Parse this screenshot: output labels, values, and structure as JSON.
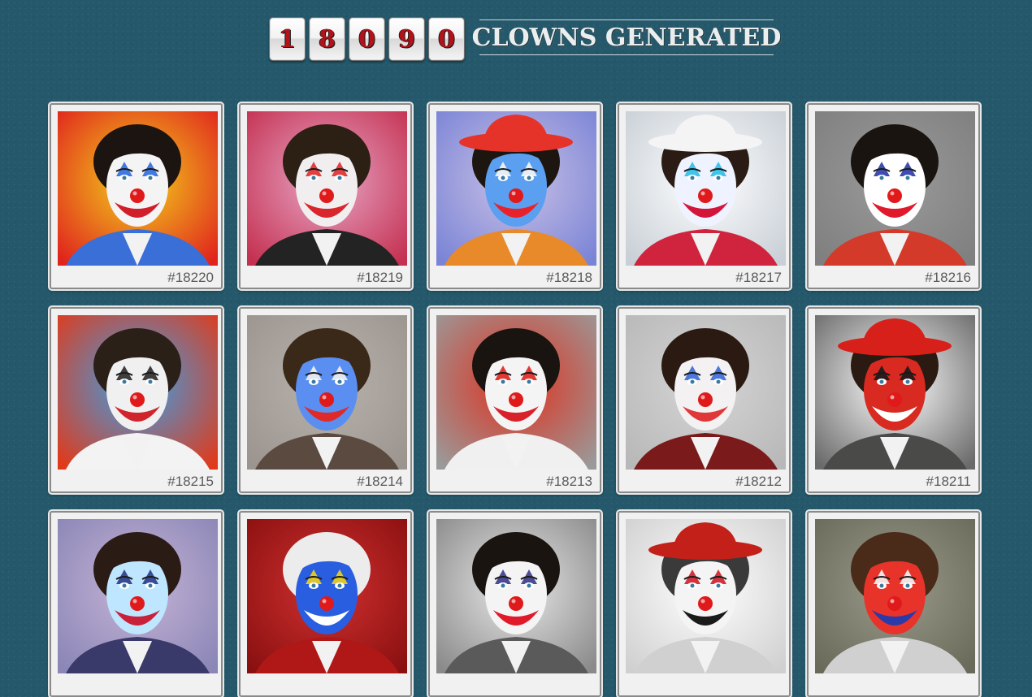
{
  "counter": {
    "digits": [
      "1",
      "8",
      "0",
      "9",
      "0"
    ],
    "label": "CLOWNS GENERATED"
  },
  "cards": [
    {
      "id": "#18220",
      "bg1": "#f3d21c",
      "bg2": "#e0231d",
      "face": "#f4f4f4",
      "paint": "#2f6be0",
      "mouth": "#d01e2a",
      "hair": "#1b1410",
      "suit": "#3b6fd8"
    },
    {
      "id": "#18219",
      "bg1": "#e8a7c8",
      "bg2": "#c43050",
      "face": "#f1eef0",
      "paint": "#e02c2c",
      "mouth": "#d8262c",
      "hair": "#2c1f14",
      "suit": "#232323"
    },
    {
      "id": "#18218",
      "bg1": "#c9c0e5",
      "bg2": "#7a84d6",
      "face": "#5b9ff0",
      "paint": "#f5f5f5",
      "mouth": "#e8222a",
      "hair": "#1d1610",
      "suit": "#e88a2a",
      "hat": "#e6332a"
    },
    {
      "id": "#18217",
      "bg1": "#ffffff",
      "bg2": "#c8cfd6",
      "face": "#eef3ff",
      "paint": "#2ebfe8",
      "mouth": "#d3153a",
      "hair": "#2a1c14",
      "suit": "#d0243e",
      "hat": "#f4f4f4"
    },
    {
      "id": "#18216",
      "bg1": "#9a9a9a",
      "bg2": "#7f7f7f",
      "face": "#ffffff",
      "paint": "#2a3aa8",
      "mouth": "#e01a2a",
      "hair": "#1a1410",
      "suit": "#d33a2a"
    },
    {
      "id": "#18215",
      "bg1": "#3aa0e8",
      "bg2": "#e03a1a",
      "face": "#f0f0f0",
      "paint": "#2a2a2a",
      "mouth": "#d0242c",
      "hair": "#2a2018",
      "suit": "#f3f3f3"
    },
    {
      "id": "#18214",
      "bg1": "#b8b2ad",
      "bg2": "#9c958f",
      "face": "#5a8ef0",
      "paint": "#f0f0f0",
      "mouth": "#e02a2a",
      "hair": "#3a2818",
      "suit": "#5a4a40"
    },
    {
      "id": "#18213",
      "bg1": "#e0301e",
      "bg2": "#9a9a9a",
      "face": "#f4f4f4",
      "paint": "#e0231d",
      "mouth": "#d8222a",
      "hair": "#1a1410",
      "suit": "#f0f0f0"
    },
    {
      "id": "#18212",
      "bg1": "#d5d5d5",
      "bg2": "#b8b8b8",
      "face": "#f3f1f1",
      "paint": "#3a6ad8",
      "mouth": "#e03838",
      "hair": "#2a1a12",
      "suit": "#7a1a1a"
    },
    {
      "id": "#18211",
      "bg1": "#ffffff",
      "bg2": "#6a6a6a",
      "face": "#d82a20",
      "paint": "#1a1a1a",
      "mouth": "#ffffff",
      "hair": "#2a1a12",
      "suit": "#4a4a48",
      "hat": "#d8201a"
    },
    {
      "id": "",
      "bg1": "#c6b4d6",
      "bg2": "#8a86b6",
      "face": "#bfe6ff",
      "paint": "#2a3a8a",
      "mouth": "#c8223a",
      "hair": "#2a1c14",
      "suit": "#3a3a6a"
    },
    {
      "id": "",
      "bg1": "#d13030",
      "bg2": "#8a1010",
      "face": "#2a5ee0",
      "paint": "#f0d21c",
      "mouth": "#ffffff",
      "hair": "#ececec",
      "suit": "#b01818"
    },
    {
      "id": "",
      "bg1": "#e8e8e8",
      "bg2": "#8a8a8a",
      "face": "#f4f4f4",
      "paint": "#3a3a8a",
      "mouth": "#e01a2a",
      "hair": "#1a1410",
      "suit": "#5a5a5a"
    },
    {
      "id": "",
      "bg1": "#ffffff",
      "bg2": "#d0d0d0",
      "face": "#f4f4f4",
      "paint": "#d01e2a",
      "mouth": "#1a1a1a",
      "hair": "#3a3a3a",
      "suit": "#d0d0d0",
      "hat": "#c4201a"
    },
    {
      "id": "",
      "bg1": "#9a9a8a",
      "bg2": "#6a6a5a",
      "face": "#e8332a",
      "paint": "#f4f4f4",
      "mouth": "#2a3aa8",
      "hair": "#4a2a18",
      "suit": "#d0d0d0"
    }
  ]
}
